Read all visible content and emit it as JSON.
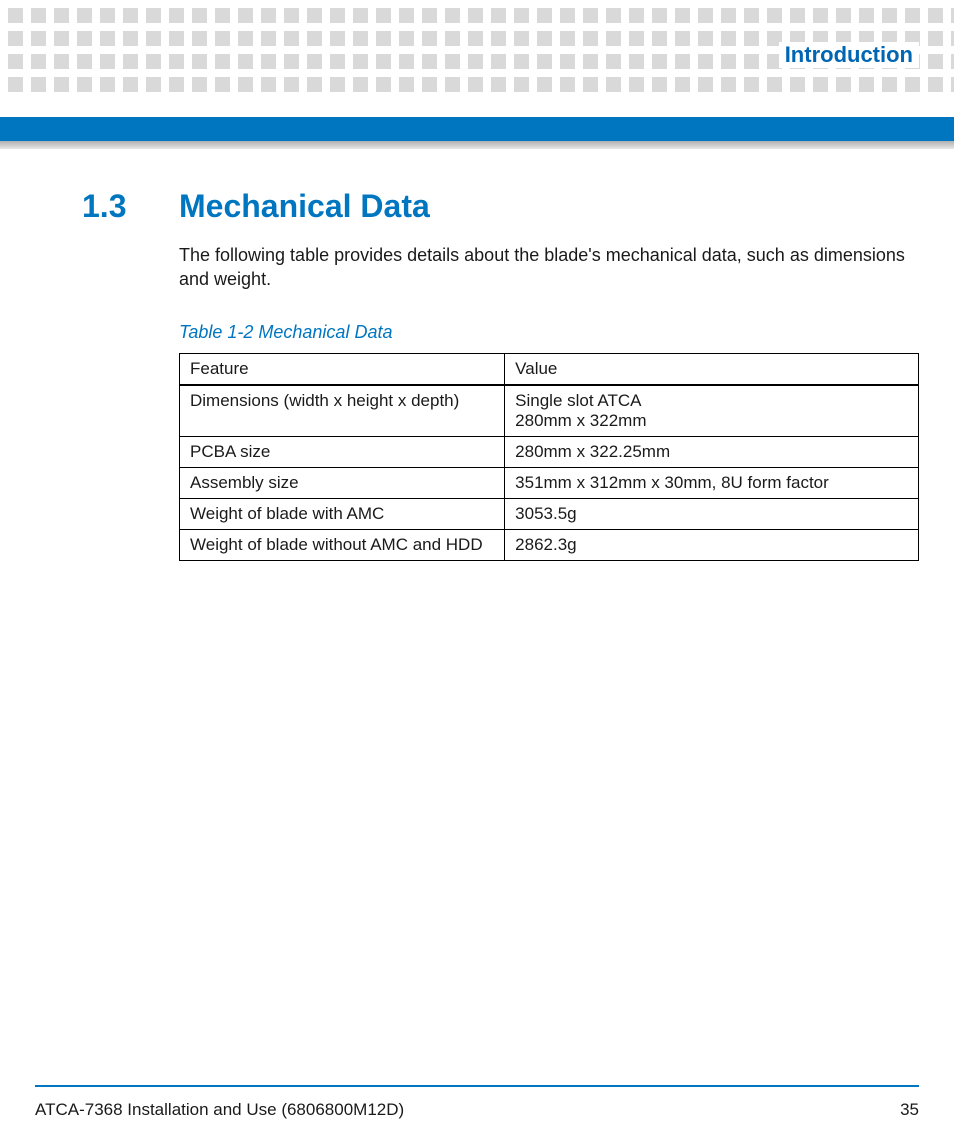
{
  "header": {
    "chapter_label": "Introduction"
  },
  "section": {
    "number": "1.3",
    "title": "Mechanical Data",
    "intro": "The following table provides details about the blade's mechanical data, such as dimensions and weight."
  },
  "table": {
    "caption": "Table 1-2 Mechanical Data",
    "headers": {
      "feature": "Feature",
      "value": "Value"
    },
    "rows": [
      {
        "feature": "Dimensions (width x height x depth)",
        "value": "Single slot ATCA\n280mm x 322mm"
      },
      {
        "feature": "PCBA size",
        "value": "280mm x 322.25mm"
      },
      {
        "feature": "Assembly size",
        "value": "351mm x 312mm x 30mm, 8U form factor"
      },
      {
        "feature": "Weight of blade with AMC",
        "value": "3053.5g"
      },
      {
        "feature": "Weight of blade without AMC and HDD",
        "value": "2862.3g"
      }
    ]
  },
  "footer": {
    "doc_title": "ATCA-7368 Installation and Use (6806800M12D)",
    "page_number": "35"
  }
}
